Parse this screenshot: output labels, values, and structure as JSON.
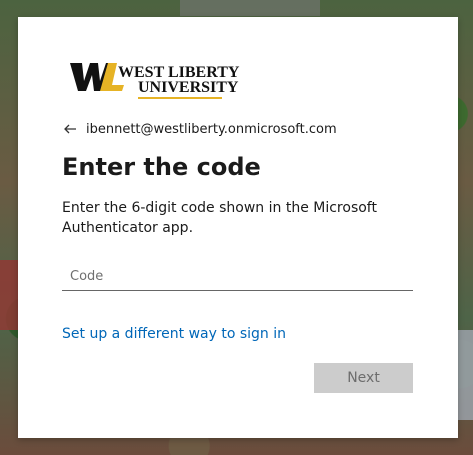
{
  "logo": {
    "line1": "WEST LIBERTY",
    "line2": "UNIVERSITY",
    "monogram": "WL",
    "colors": {
      "gold": "#e6b325",
      "black": "#111111"
    }
  },
  "account": {
    "email": "ibennett@westliberty.onmicrosoft.com",
    "back_icon": "arrow-left-icon"
  },
  "title": "Enter the code",
  "description": "Enter the 6-digit code shown in the Microsoft Authenticator app.",
  "code_input": {
    "placeholder": "Code",
    "value": ""
  },
  "alt_link": "Set up a different way to sign in",
  "next_button": "Next",
  "colors": {
    "link": "#0067b8",
    "button_disabled_bg": "#cccccc",
    "button_disabled_text": "#6d6d6d"
  }
}
